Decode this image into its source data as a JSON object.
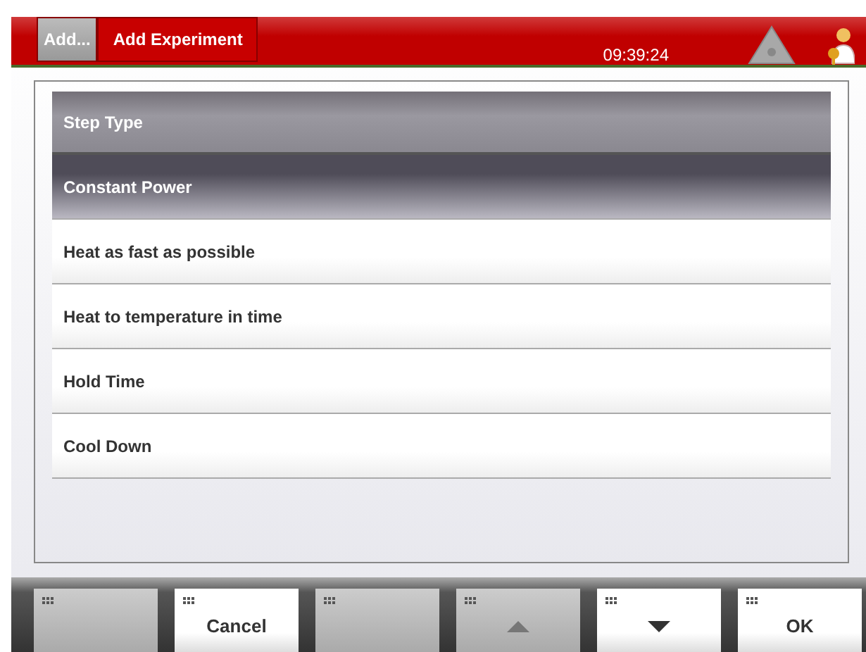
{
  "header": {
    "breadcrumbs": [
      {
        "label": "Add...",
        "selected": false
      },
      {
        "label": "Add Experiment",
        "selected": true
      }
    ],
    "time": "09:39:24"
  },
  "list": {
    "title": "Step Type",
    "items": [
      {
        "label": "Constant Power",
        "selected": true
      },
      {
        "label": "Heat as fast as possible",
        "selected": false
      },
      {
        "label": "Heat to temperature in time",
        "selected": false
      },
      {
        "label": "Hold Time",
        "selected": false
      },
      {
        "label": "Cool Down",
        "selected": false
      }
    ]
  },
  "buttons": [
    {
      "kind": "blank",
      "disabled": true
    },
    {
      "kind": "text",
      "label": "Cancel",
      "disabled": false
    },
    {
      "kind": "blank",
      "disabled": true
    },
    {
      "kind": "up",
      "disabled": true
    },
    {
      "kind": "down",
      "disabled": false
    },
    {
      "kind": "text",
      "label": "OK",
      "disabled": false
    }
  ]
}
